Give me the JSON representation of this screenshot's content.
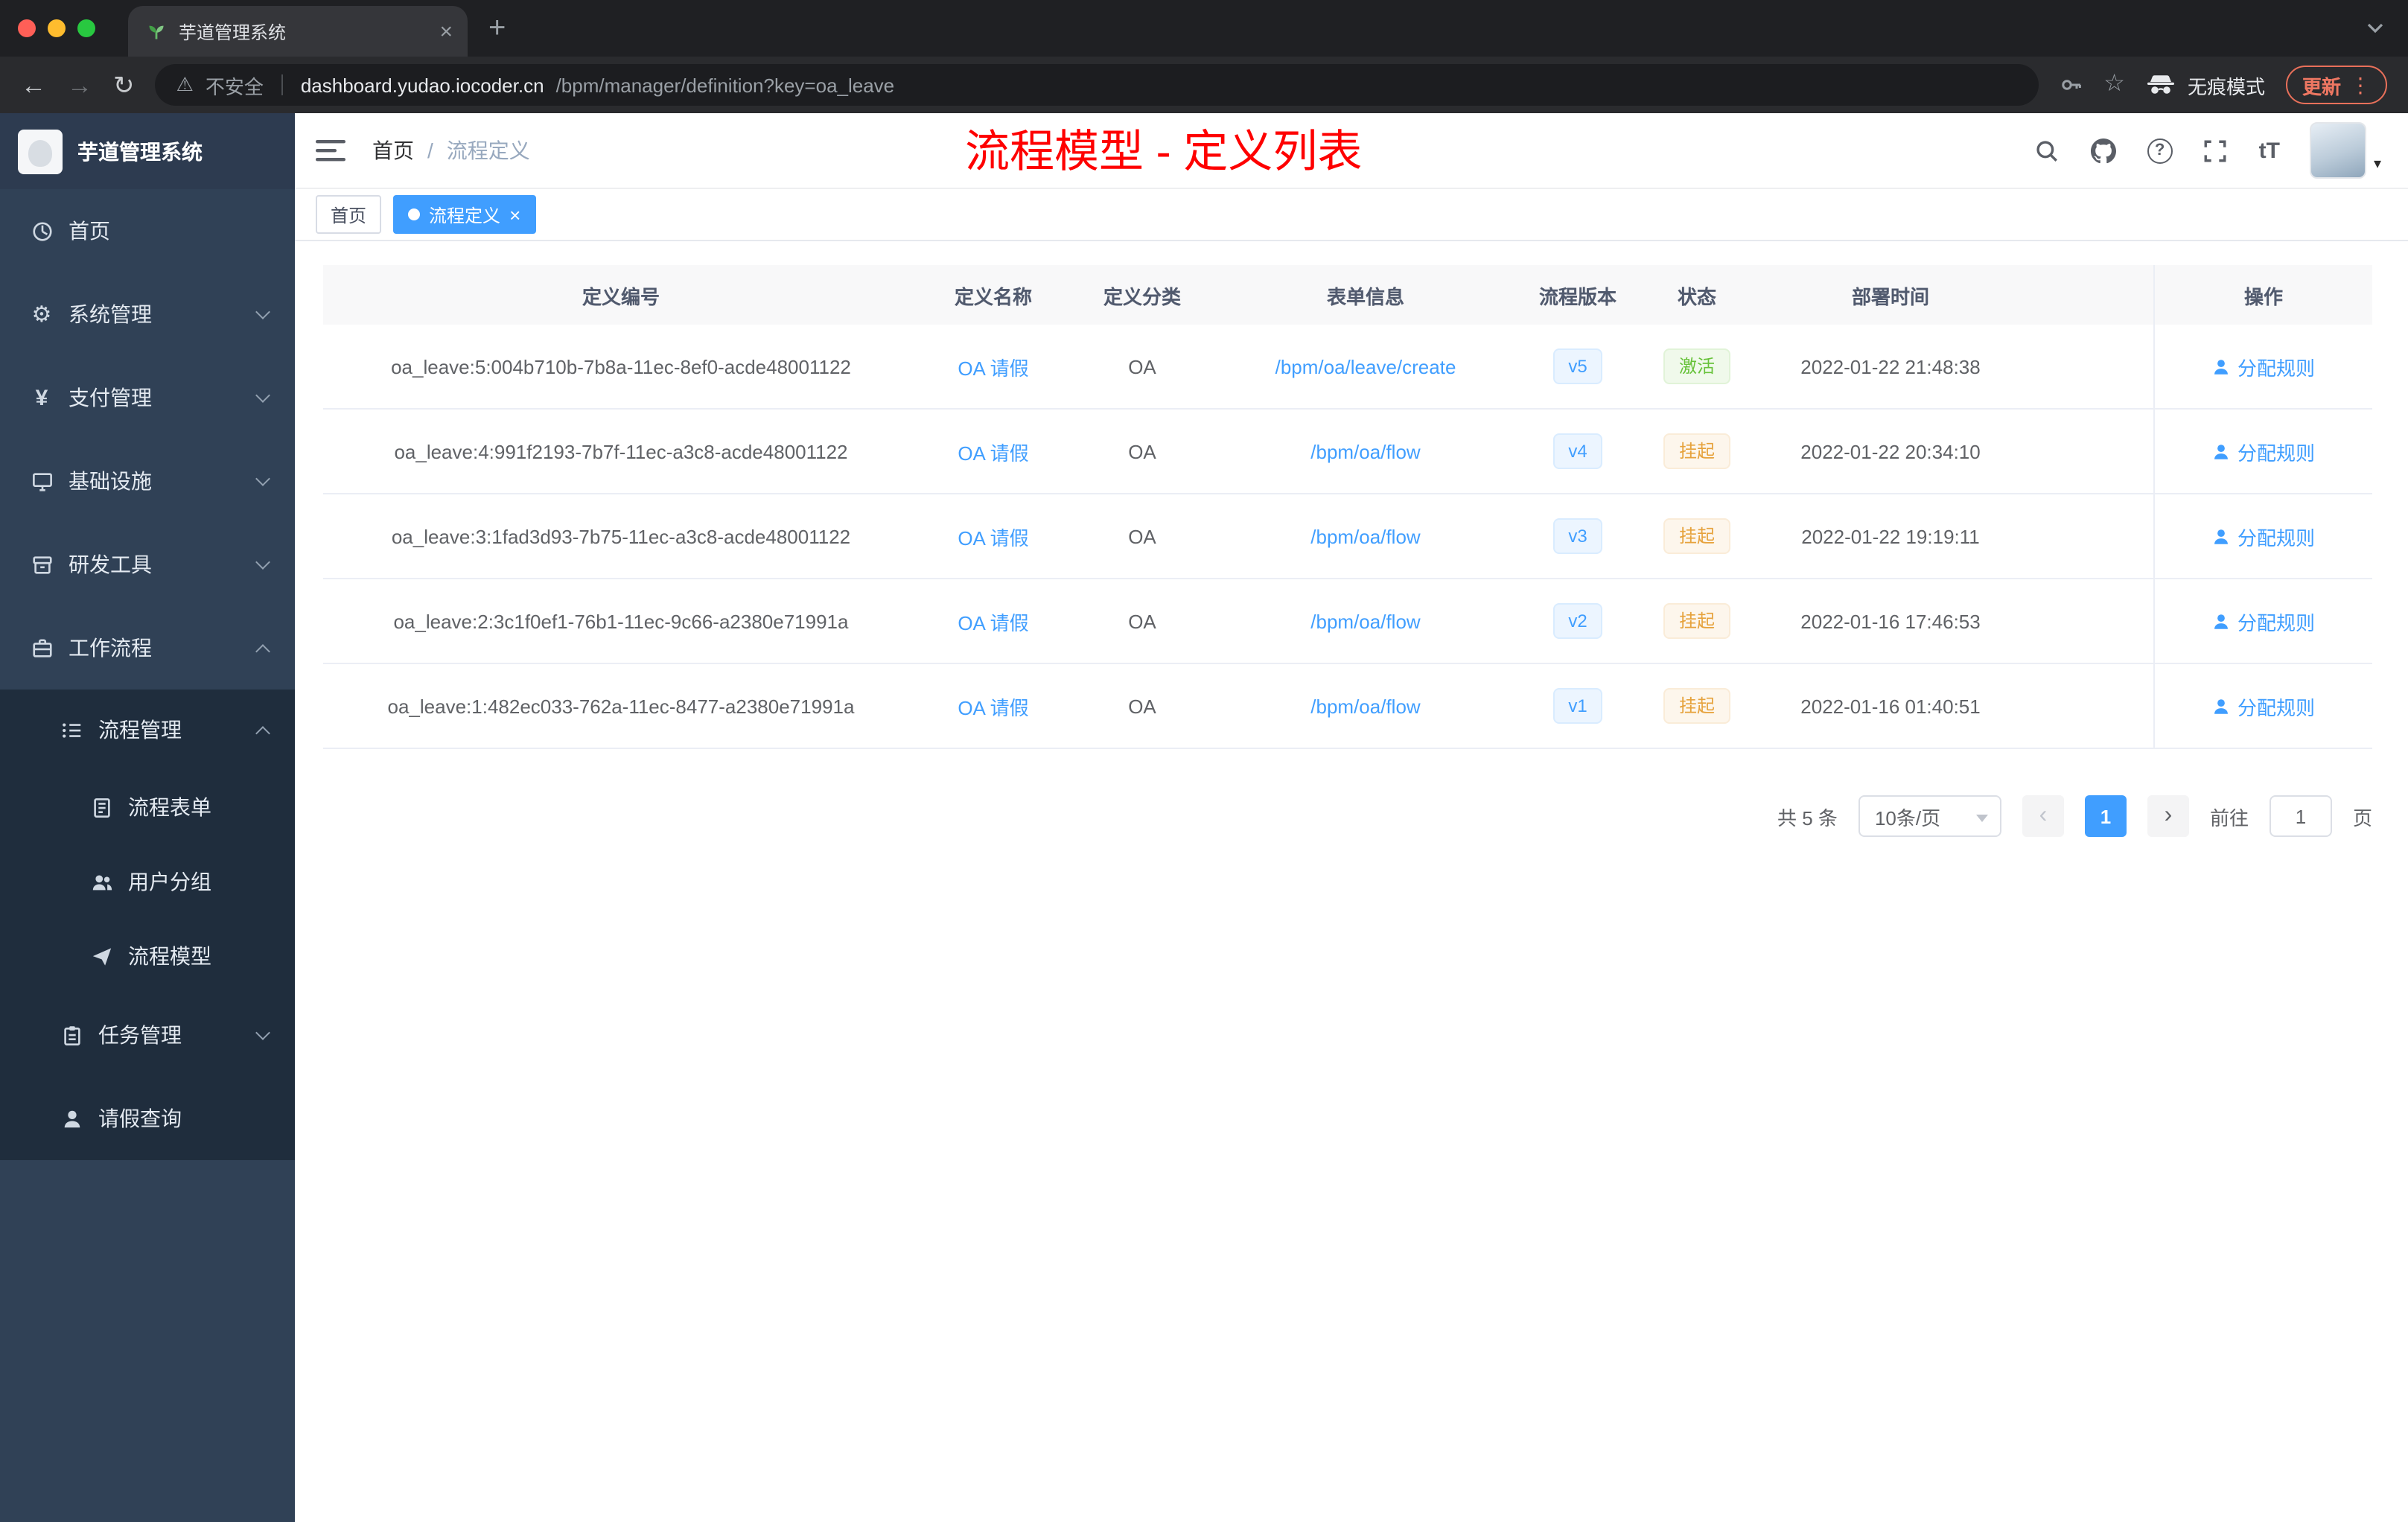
{
  "colors": {
    "accent": "#409eff",
    "success": "#67c23a",
    "warning": "#e6a23c",
    "annotation_red": "#fe0000",
    "sidebar_bg": "#304156",
    "submenu_bg": "#1f2d3d"
  },
  "browser": {
    "tab_title": "芋道管理系统",
    "security_label": "不安全",
    "url_host": "dashboard.yudao.iocoder.cn",
    "url_path": "/bpm/manager/definition?key=oa_leave",
    "incognito_label": "无痕模式",
    "update_label": "更新"
  },
  "sidebar": {
    "title": "芋道管理系统",
    "items": [
      {
        "label": "首页"
      },
      {
        "label": "系统管理"
      },
      {
        "label": "支付管理"
      },
      {
        "label": "基础设施"
      },
      {
        "label": "研发工具"
      },
      {
        "label": "工作流程"
      },
      {
        "label": "流程管理"
      },
      {
        "label": "流程表单"
      },
      {
        "label": "用户分组"
      },
      {
        "label": "流程模型"
      },
      {
        "label": "任务管理"
      },
      {
        "label": "请假查询"
      }
    ]
  },
  "navbar": {
    "breadcrumb_home": "首页",
    "breadcrumb_separator": "/",
    "breadcrumb_current": "流程定义",
    "annotation": "流程模型 - 定义列表"
  },
  "tags": {
    "home": "首页",
    "active": "流程定义"
  },
  "table": {
    "columns": [
      "定义编号",
      "定义名称",
      "定义分类",
      "表单信息",
      "流程版本",
      "状态",
      "部署时间",
      "操作"
    ],
    "rows": [
      {
        "id": "oa_leave:5:004b710b-7b8a-11ec-8ef0-acde48001122",
        "name": "OA 请假",
        "category": "OA",
        "form": "/bpm/oa/leave/create",
        "version": "v5",
        "status": "激活",
        "status_type": "success",
        "deploy_time": "2022-01-22 21:48:38",
        "action": "分配规则"
      },
      {
        "id": "oa_leave:4:991f2193-7b7f-11ec-a3c8-acde48001122",
        "name": "OA 请假",
        "category": "OA",
        "form": "/bpm/oa/flow",
        "version": "v4",
        "status": "挂起",
        "status_type": "warning",
        "deploy_time": "2022-01-22 20:34:10",
        "action": "分配规则"
      },
      {
        "id": "oa_leave:3:1fad3d93-7b75-11ec-a3c8-acde48001122",
        "name": "OA 请假",
        "category": "OA",
        "form": "/bpm/oa/flow",
        "version": "v3",
        "status": "挂起",
        "status_type": "warning",
        "deploy_time": "2022-01-22 19:19:11",
        "action": "分配规则"
      },
      {
        "id": "oa_leave:2:3c1f0ef1-76b1-11ec-9c66-a2380e71991a",
        "name": "OA 请假",
        "category": "OA",
        "form": "/bpm/oa/flow",
        "version": "v2",
        "status": "挂起",
        "status_type": "warning",
        "deploy_time": "2022-01-16 17:46:53",
        "action": "分配规则"
      },
      {
        "id": "oa_leave:1:482ec033-762a-11ec-8477-a2380e71991a",
        "name": "OA 请假",
        "category": "OA",
        "form": "/bpm/oa/flow",
        "version": "v1",
        "status": "挂起",
        "status_type": "warning",
        "deploy_time": "2022-01-16 01:40:51",
        "action": "分配规则"
      }
    ]
  },
  "pagination": {
    "total": "共 5 条",
    "page_size": "10条/页",
    "current_page": "1",
    "goto_label": "前往",
    "goto_value": "1",
    "page_unit": "页"
  }
}
